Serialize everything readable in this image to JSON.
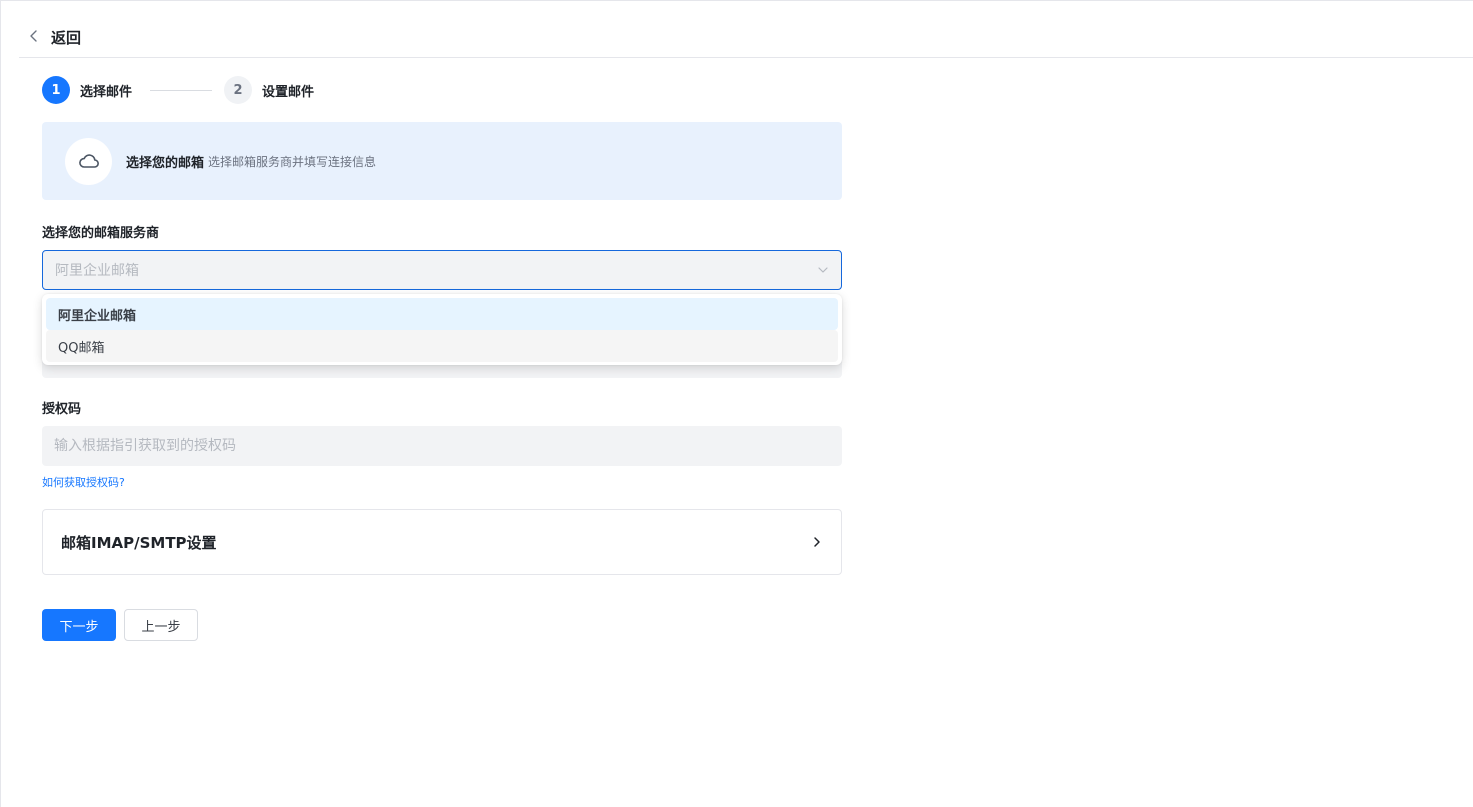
{
  "header": {
    "back_label": "返回"
  },
  "steps": [
    {
      "num": "1",
      "label": "选择邮件"
    },
    {
      "num": "2",
      "label": "设置邮件"
    }
  ],
  "banner": {
    "title": "选择您的邮箱",
    "subtitle": "选择邮箱服务商并填写连接信息"
  },
  "provider": {
    "label": "选择您的邮箱服务商",
    "selected": "阿里企业邮箱",
    "options": [
      "阿里企业邮箱",
      "QQ邮箱"
    ]
  },
  "auth_code": {
    "label": "授权码",
    "placeholder": "输入根据指引获取到的授权码",
    "help_link": "如何获取授权码?"
  },
  "imap_settings": {
    "title": "邮箱IMAP/SMTP设置"
  },
  "actions": {
    "next": "下一步",
    "prev": "上一步"
  },
  "colors": {
    "primary": "#1677ff",
    "banner_bg": "#e8f1fd",
    "field_bg": "#f2f3f5"
  }
}
